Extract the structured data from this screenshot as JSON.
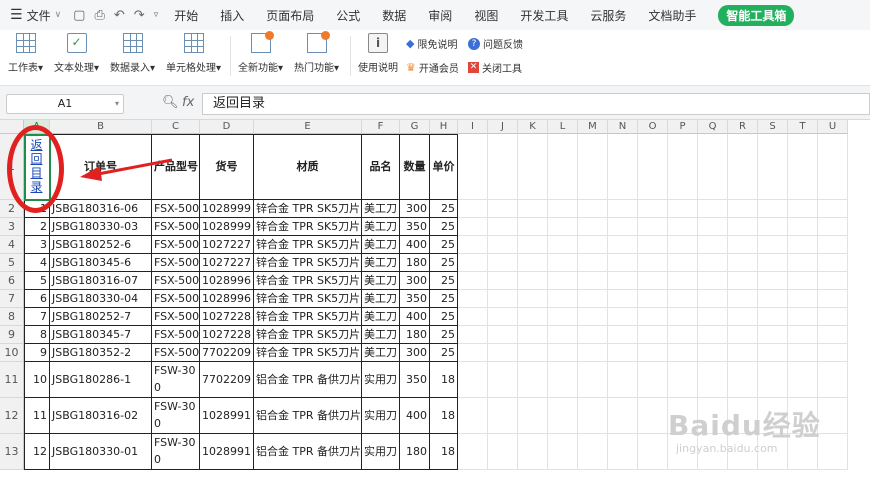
{
  "menu": {
    "file": "文件",
    "tabs": [
      "开始",
      "插入",
      "页面布局",
      "公式",
      "数据",
      "审阅",
      "视图",
      "开发工具",
      "云服务",
      "文档助手",
      "智能工具箱"
    ]
  },
  "ribbon": {
    "buttons": [
      "工作表",
      "文本处理",
      "数据录入",
      "单元格处理",
      "全新功能",
      "热门功能",
      "使用说明"
    ],
    "side_items": [
      "限免说明",
      "问题反馈",
      "开通会员",
      "关闭工具"
    ]
  },
  "formula": {
    "cell_ref": "A1",
    "fx": "fx",
    "content": "返回目录"
  },
  "columns": [
    "A",
    "B",
    "C",
    "D",
    "E",
    "F",
    "G",
    "H",
    "I",
    "J",
    "K",
    "L",
    "M",
    "N",
    "O",
    "P",
    "Q",
    "R",
    "S",
    "T",
    "U"
  ],
  "rows": [
    "1",
    "2",
    "3",
    "4",
    "5",
    "6",
    "7",
    "8",
    "9",
    "10",
    "11",
    "12",
    "13"
  ],
  "table": {
    "back_link": "返回目录",
    "headers": [
      "订单号",
      "产品型号",
      "货号",
      "材质",
      "品名",
      "数量",
      "单价"
    ],
    "data": [
      [
        "1",
        "JSBG180316-06",
        "FSX-500",
        "1028999",
        "锌合金  TPR SK5刀片",
        "美工刀",
        "300",
        "25"
      ],
      [
        "2",
        "JSBG180330-03",
        "FSX-500",
        "1028999",
        "锌合金  TPR SK5刀片",
        "美工刀",
        "350",
        "25"
      ],
      [
        "3",
        "JSBG180252-6",
        "FSX-500",
        "1027227",
        "锌合金  TPR SK5刀片",
        "美工刀",
        "400",
        "25"
      ],
      [
        "4",
        "JSBG180345-6",
        "FSX-500",
        "1027227",
        "锌合金  TPR SK5刀片",
        "美工刀",
        "180",
        "25"
      ],
      [
        "5",
        "JSBG180316-07",
        "FSX-500",
        "1028996",
        "锌合金  TPR SK5刀片",
        "美工刀",
        "300",
        "25"
      ],
      [
        "6",
        "JSBG180330-04",
        "FSX-500",
        "1028996",
        "锌合金  TPR SK5刀片",
        "美工刀",
        "350",
        "25"
      ],
      [
        "7",
        "JSBG180252-7",
        "FSX-500",
        "1027228",
        "锌合金  TPR SK5刀片",
        "美工刀",
        "400",
        "25"
      ],
      [
        "8",
        "JSBG180345-7",
        "FSX-500",
        "1027228",
        "锌合金  TPR SK5刀片",
        "美工刀",
        "180",
        "25"
      ],
      [
        "9",
        "JSBG180352-2",
        "FSX-500",
        "7702209",
        "锌合金  TPR SK5刀片",
        "美工刀",
        "300",
        "25"
      ],
      [
        "10",
        "JSBG180286-1",
        "FSW-300",
        "7702209",
        "铝合金  TPR 备供刀片",
        "实用刀",
        "350",
        "18"
      ],
      [
        "11",
        "JSBG180316-02",
        "FSW-300",
        "1028991",
        "铝合金  TPR 备供刀片",
        "实用刀",
        "400",
        "18"
      ],
      [
        "12",
        "JSBG180330-01",
        "FSW-300",
        "1028991",
        "铝合金  TPR 备供刀片",
        "实用刀",
        "180",
        "18"
      ]
    ]
  },
  "watermark": {
    "brand": "Baidu经验",
    "url": "jingyan.baidu.com"
  },
  "colors": {
    "accent": "#22b05e",
    "annotation": "#e1211f",
    "link": "#1a46b8"
  }
}
